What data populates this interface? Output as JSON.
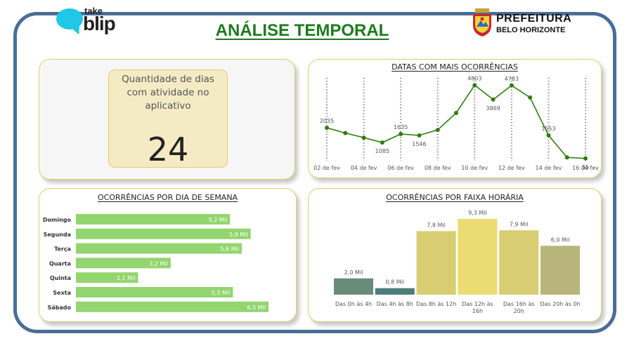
{
  "header": {
    "brand_small": "take",
    "brand_large": "blip",
    "title": "ANÁLISE TEMPORAL",
    "org_line1": "PREFEITURA",
    "org_line2": "BELO HORIZONTE"
  },
  "kpi": {
    "label": "Quantidade de dias com atividade no aplicativo",
    "value": "24"
  },
  "colors": {
    "frame": "#4a6e96",
    "title": "#1e7a1e",
    "line": "#2f7d0e",
    "weekday_bar": "#93d56f",
    "card_border": "#e3cc6e"
  },
  "chart_data": [
    {
      "type": "line",
      "title": "DATAS COM MAIS OCORRÊNCIAS",
      "x_ticks": [
        "02 de fev",
        "04 de fev",
        "06 de fev",
        "08 de fev",
        "10 de fev",
        "12 de fev",
        "14 de fev",
        "16 de fev"
      ],
      "x": [
        "02 de fev",
        "03 de fev",
        "04 de fev",
        "05 de fev",
        "06 de fev",
        "07 de fev",
        "08 de fev",
        "09 de fev",
        "10 de fev",
        "11 de fev",
        "12 de fev",
        "13 de fev",
        "14 de fev",
        "15 de fev",
        "16 de fev"
      ],
      "values": [
        2035,
        1700,
        1400,
        1085,
        1635,
        1546,
        1900,
        3000,
        4803,
        3869,
        4783,
        4000,
        1553,
        120,
        55
      ],
      "labels": [
        "2035",
        "",
        "",
        "1085",
        "1635",
        "1546",
        "",
        "",
        "4803",
        "3869",
        "4783",
        "",
        "1553",
        "",
        "55"
      ],
      "ylim": [
        0,
        5000
      ],
      "grid": "dashed vertical"
    },
    {
      "type": "bar",
      "orientation": "horizontal",
      "title": "OCORRÊNCIAS POR DIA DE SEMANA",
      "categories": [
        "Domingo",
        "Segunda",
        "Terça",
        "Quarta",
        "Quinta",
        "Sexta",
        "Sábado"
      ],
      "values": [
        5.2,
        5.9,
        5.6,
        3.2,
        2.1,
        5.3,
        6.5
      ],
      "labels": [
        "5,2 Mil",
        "5,9 Mil",
        "5,6 Mil",
        "3,2 Mil",
        "2,1 Mil",
        "5,3 Mil",
        "6,5 Mil"
      ],
      "unit": "Mil",
      "xlim": [
        0,
        6.5
      ]
    },
    {
      "type": "bar",
      "orientation": "vertical",
      "title": "OCORRÊNCIAS POR FAIXA HORÁRIA",
      "categories": [
        "Das 0h às 4h",
        "Das 4h às 8h",
        "Das 8h às 12h",
        "Das 12h às 16h",
        "Das 16h às 20h",
        "Das 20h às 0h"
      ],
      "values": [
        2.0,
        0.8,
        7.8,
        9.3,
        7.9,
        6.0
      ],
      "labels": [
        "2,0 Mil",
        "0,8 Mil",
        "7,8 Mil",
        "9,3 Mil",
        "7,9 Mil",
        "6,0 Mil"
      ],
      "colors": [
        "#6a8b7a",
        "#4d7f7a",
        "#d8cd73",
        "#ecdb70",
        "#d8cd73",
        "#b8b57a"
      ],
      "unit": "Mil",
      "ylim": [
        0,
        9.3
      ]
    }
  ]
}
